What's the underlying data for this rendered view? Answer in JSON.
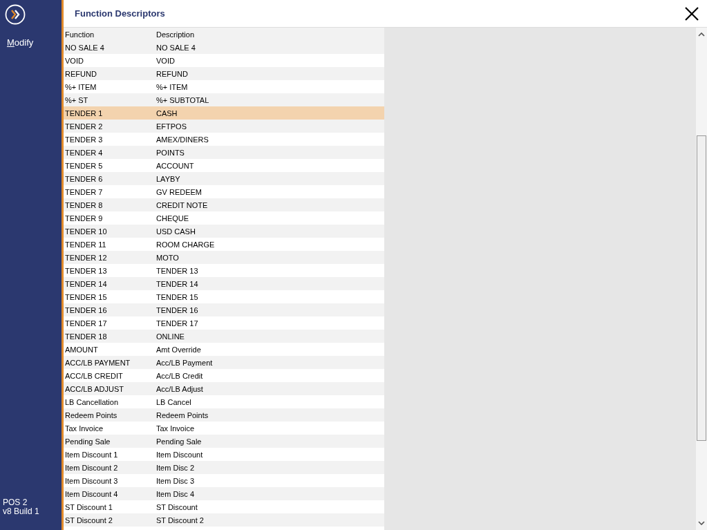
{
  "sidebar": {
    "action": "Modify",
    "footer": [
      "POS 2",
      "v8 Build 1"
    ]
  },
  "window": {
    "title": "Function Descriptors"
  },
  "table": {
    "columns": [
      "Function",
      "Description"
    ],
    "rows": [
      {
        "function": "NO SALE 4",
        "description": "NO SALE 4",
        "selected": false
      },
      {
        "function": "VOID",
        "description": "VOID",
        "selected": false
      },
      {
        "function": "REFUND",
        "description": "REFUND",
        "selected": false
      },
      {
        "function": "%+ ITEM",
        "description": "%+ ITEM",
        "selected": false
      },
      {
        "function": "%+ ST",
        "description": "%+ SUBTOTAL",
        "selected": false
      },
      {
        "function": "TENDER 1",
        "description": "CASH",
        "selected": true
      },
      {
        "function": "TENDER 2",
        "description": "EFTPOS",
        "selected": false
      },
      {
        "function": "TENDER 3",
        "description": "AMEX/DINERS",
        "selected": false
      },
      {
        "function": "TENDER 4",
        "description": "POINTS",
        "selected": false
      },
      {
        "function": "TENDER 5",
        "description": "ACCOUNT",
        "selected": false
      },
      {
        "function": "TENDER 6",
        "description": "LAYBY",
        "selected": false
      },
      {
        "function": "TENDER 7",
        "description": "GV REDEEM",
        "selected": false
      },
      {
        "function": "TENDER 8",
        "description": "CREDIT NOTE",
        "selected": false
      },
      {
        "function": "TENDER 9",
        "description": "CHEQUE",
        "selected": false
      },
      {
        "function": "TENDER 10",
        "description": "USD CASH",
        "selected": false
      },
      {
        "function": "TENDER 11",
        "description": "ROOM CHARGE",
        "selected": false
      },
      {
        "function": "TENDER 12",
        "description": "MOTO",
        "selected": false
      },
      {
        "function": "TENDER 13",
        "description": "TENDER 13",
        "selected": false
      },
      {
        "function": "TENDER 14",
        "description": "TENDER 14",
        "selected": false
      },
      {
        "function": "TENDER 15",
        "description": "TENDER 15",
        "selected": false
      },
      {
        "function": "TENDER 16",
        "description": "TENDER 16",
        "selected": false
      },
      {
        "function": "TENDER 17",
        "description": "TENDER 17",
        "selected": false
      },
      {
        "function": "TENDER 18",
        "description": "ONLINE",
        "selected": false
      },
      {
        "function": "AMOUNT",
        "description": "Amt Override",
        "selected": false
      },
      {
        "function": "ACC/LB PAYMENT",
        "description": "Acc/LB Payment",
        "selected": false
      },
      {
        "function": "ACC/LB CREDIT",
        "description": "Acc/LB Credit",
        "selected": false
      },
      {
        "function": "ACC/LB ADJUST",
        "description": "Acc/LB Adjust",
        "selected": false
      },
      {
        "function": "LB Cancellation",
        "description": "LB Cancel",
        "selected": false
      },
      {
        "function": "Redeem Points",
        "description": "Redeem Points",
        "selected": false
      },
      {
        "function": "Tax Invoice",
        "description": "Tax Invoice",
        "selected": false
      },
      {
        "function": "Pending Sale",
        "description": "Pending Sale",
        "selected": false
      },
      {
        "function": "Item Discount 1",
        "description": "Item Discount",
        "selected": false
      },
      {
        "function": "Item Discount 2",
        "description": "Item Disc 2",
        "selected": false
      },
      {
        "function": "Item Discount 3",
        "description": "Item Disc 3",
        "selected": false
      },
      {
        "function": "Item Discount 4",
        "description": "Item Disc 4",
        "selected": false
      },
      {
        "function": "ST Discount 1",
        "description": "ST Discount",
        "selected": false
      },
      {
        "function": "ST Discount 2",
        "description": "ST Discount 2",
        "selected": false
      }
    ]
  }
}
